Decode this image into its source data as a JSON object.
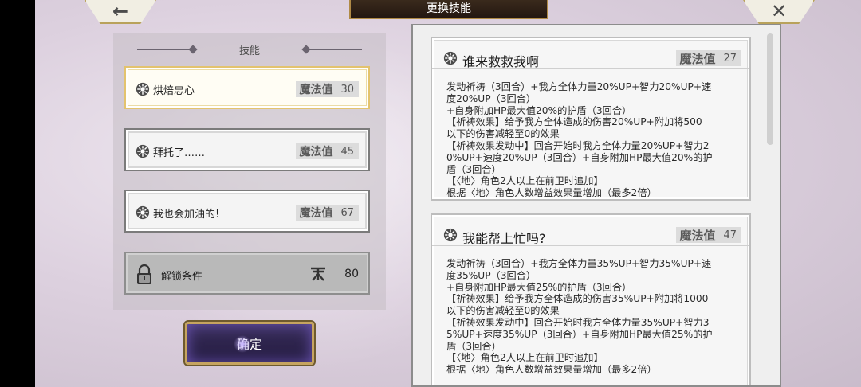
{
  "header": {
    "title": "更换技能",
    "back_glyph": "←",
    "close_glyph": "✕"
  },
  "skill_list": {
    "header": "技能",
    "items": [
      {
        "name": "烘焙忠心",
        "mp_label": "魔法值",
        "mp": "30",
        "state": "selected"
      },
      {
        "name": "拜托了……",
        "mp_label": "魔法值",
        "mp": "45",
        "state": "normal"
      },
      {
        "name": "我也会加油的!",
        "mp_label": "魔法值",
        "mp": "67",
        "state": "normal"
      }
    ],
    "locked": {
      "label": "解锁条件",
      "value": "80",
      "icon": "lock-icon",
      "req_icon": "level-badge-icon"
    }
  },
  "confirm_label": "确定",
  "details": [
    {
      "title": "谁来救救我啊",
      "mp_label": "魔法值",
      "mp": "27",
      "lines": [
        "发动祈祷（3回合）+我方全体力量20%UP+智力20%UP+速",
        "度20%UP（3回合）",
        "+自身附加HP最大值20%的护盾（3回合）",
        "【祈祷效果】给予我方全体造成的伤害20%UP+附加将500",
        "以下的伤害减轻至0的效果",
        "【祈祷效果发动中】回合开始时我方全体力量20%UP+智力2",
        "0%UP+速度20%UP（3回合）+自身附加HP最大值20%的护",
        "盾（3回合）",
        "【〈地〉角色2人以上在前卫时追加】",
        "根据〈地〉角色人数增益效果量增加（最多2倍）"
      ]
    },
    {
      "title": "我能帮上忙吗?",
      "mp_label": "魔法值",
      "mp": "47",
      "lines": [
        "发动祈祷（3回合）+我方全体力量35%UP+智力35%UP+速",
        "度35%UP（3回合）",
        "+自身附加HP最大值25%的护盾（3回合）",
        "【祈祷效果】给予我方全体造成的伤害35%UP+附加将1000",
        "以下的伤害减轻至0的效果",
        "【祈祷效果发动中】回合开始时我方全体力量35%UP+智力3",
        "5%UP+速度35%UP（3回合）+自身附加HP最大值25%的护",
        "盾（3回合）",
        "【〈地〉角色2人以上在前卫时追加】",
        "根据〈地〉角色人数增益效果量增加（最多2倍）"
      ]
    }
  ],
  "colors": {
    "accent_gold": "#c6a460",
    "confirm_bg": "#2c2350"
  }
}
